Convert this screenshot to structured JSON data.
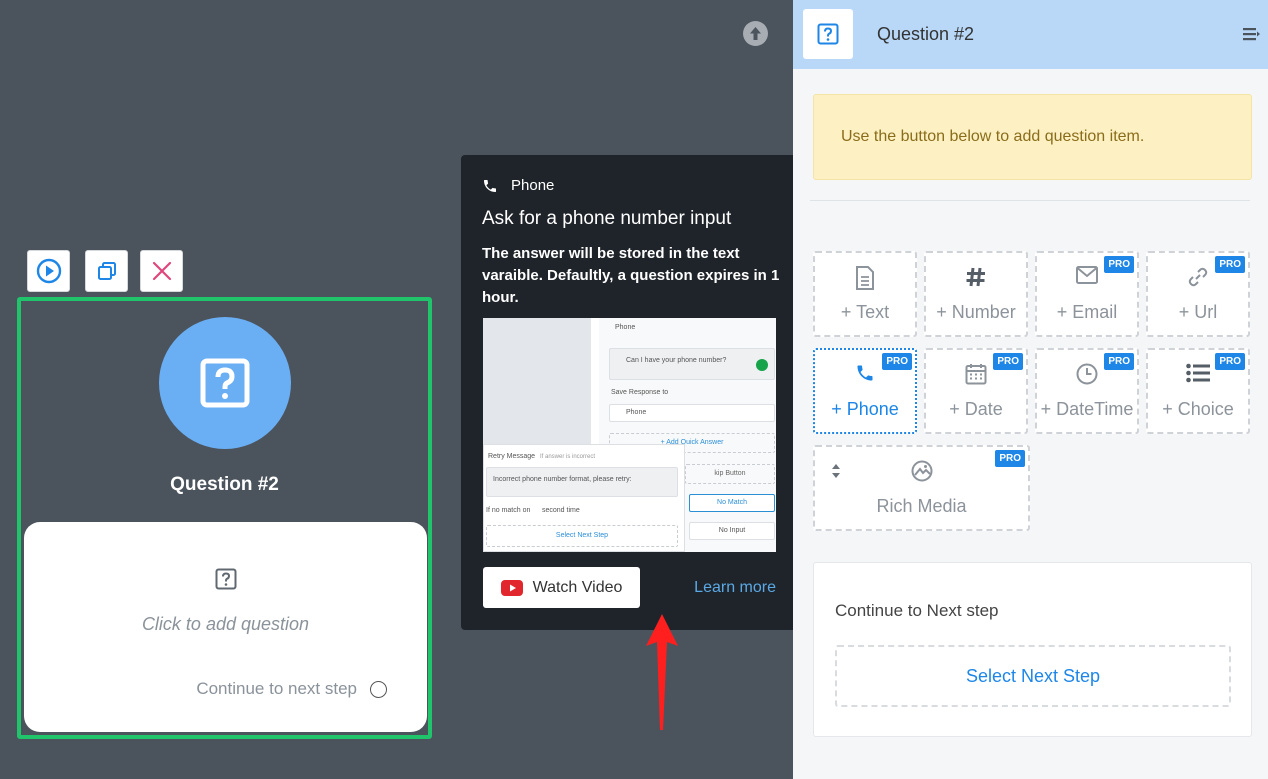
{
  "canvas": {
    "node": {
      "title": "Question #2",
      "card_prompt": "Click to add question",
      "continue_label": "Continue to next step"
    }
  },
  "tooltip": {
    "type_label": "Phone",
    "title": "Ask for a phone number input",
    "description": "The answer will be stored in the text varaible. Defaultly, a question expires in 1 hour.",
    "preview": {
      "header": "Phone",
      "question": "Can I have your phone number?",
      "save_response": "Save Response to",
      "select_value": "Phone",
      "add_quick_answer": "+ Add Quick Answer",
      "skip_button": "kip Button",
      "retry_label": "Retry Message",
      "retry_hint": "If answer is incorrect",
      "retry_text": "Incorrect phone number format, please retry:",
      "no_match": "No Match",
      "if_no_match": "If no match on",
      "second_time": "second time",
      "no_input": "No Input",
      "select_next": "Select Next Step"
    },
    "watch_label": "Watch Video",
    "learn_label": "Learn more"
  },
  "panel": {
    "title": "Question #2",
    "info": "Use the button below to add question item.",
    "pro_badge": "PRO",
    "tiles": [
      {
        "label": "+ Text",
        "icon": "document-icon",
        "pro": false
      },
      {
        "label": "+ Number",
        "icon": "hash-icon",
        "pro": false
      },
      {
        "label": "+ Email",
        "icon": "envelope-icon",
        "pro": true
      },
      {
        "label": "+ Url",
        "icon": "link-icon",
        "pro": true
      },
      {
        "label": "+ Phone",
        "icon": "phone-icon",
        "pro": true,
        "active": true
      },
      {
        "label": "+ Date",
        "icon": "calendar-icon",
        "pro": true
      },
      {
        "label": "+ DateTime",
        "icon": "clock-icon",
        "pro": true
      },
      {
        "label": "+ Choice",
        "icon": "list-icon",
        "pro": true
      },
      {
        "label": "Rich Media",
        "icon": "image-icon",
        "pro": true
      }
    ],
    "continue_title": "Continue to Next step",
    "select_next": "Select Next Step"
  },
  "colors": {
    "canvas_bg": "#4b545c",
    "node_border": "#1fc46b",
    "node_circle": "#6aaef4",
    "accent": "#1d86e7",
    "tooltip_bg": "#1f242a",
    "header_bg": "#b9d8f8",
    "info_bg": "#fdf1c4",
    "annotation_arrow": "#ff1f1f"
  }
}
